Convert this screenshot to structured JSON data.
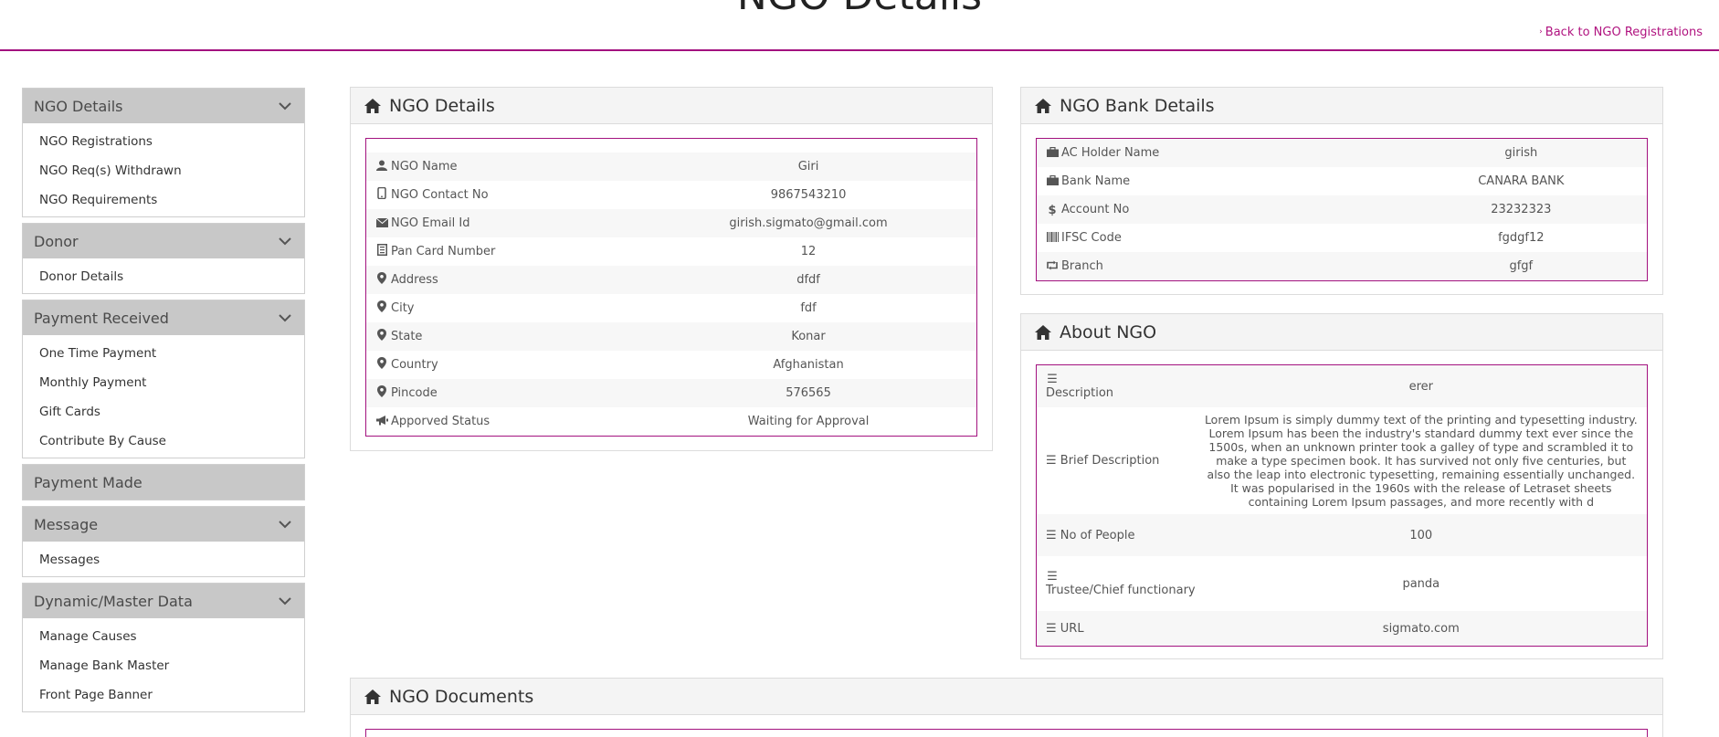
{
  "page": {
    "title": "NGO Details",
    "back_link": "Back to NGO Registrations"
  },
  "sidebar": {
    "groups": [
      {
        "title": "NGO Details",
        "has_chevron": true,
        "items": [
          "NGO Registrations",
          "NGO Req(s) Withdrawn",
          "NGO Requirements"
        ]
      },
      {
        "title": "Donor",
        "has_chevron": true,
        "items": [
          "Donor Details"
        ]
      },
      {
        "title": "Payment Received",
        "has_chevron": true,
        "items": [
          "One Time Payment",
          "Monthly Payment",
          "Gift Cards",
          "Contribute By Cause"
        ]
      },
      {
        "title": "Payment Made",
        "has_chevron": false,
        "items": []
      },
      {
        "title": "Message",
        "has_chevron": true,
        "items": [
          "Messages"
        ]
      },
      {
        "title": "Dynamic/Master Data",
        "has_chevron": true,
        "items": [
          "Manage Causes",
          "Manage Bank Master",
          "Front Page Banner"
        ]
      }
    ]
  },
  "ngo_details": {
    "title": "NGO Details",
    "rows": [
      {
        "icon": "user-icon",
        "label": "NGO Name",
        "value": "Giri"
      },
      {
        "icon": "phone-icon",
        "label": "NGO Contact No",
        "value": "9867543210"
      },
      {
        "icon": "envelope-icon",
        "label": "NGO Email Id",
        "value": "girish.sigmato@gmail.com"
      },
      {
        "icon": "card-icon",
        "label": "Pan Card Number",
        "value": "12"
      },
      {
        "icon": "map-marker-icon",
        "label": "Address",
        "value": "dfdf"
      },
      {
        "icon": "map-marker-icon",
        "label": "City",
        "value": "fdf"
      },
      {
        "icon": "map-marker-icon",
        "label": "State",
        "value": "Konar"
      },
      {
        "icon": "map-marker-icon",
        "label": "Country",
        "value": "Afghanistan"
      },
      {
        "icon": "map-marker-icon",
        "label": "Pincode",
        "value": "576565"
      },
      {
        "icon": "bullhorn-icon",
        "label": "Apporved Status",
        "value": "Waiting for Approval"
      }
    ]
  },
  "bank_details": {
    "title": "NGO Bank Details",
    "rows": [
      {
        "icon": "briefcase-icon",
        "label": "AC Holder Name",
        "value": "girish"
      },
      {
        "icon": "briefcase-icon",
        "label": "Bank Name",
        "value": "CANARA BANK"
      },
      {
        "icon": "dollar-icon",
        "label": "Account No",
        "value": "23232323"
      },
      {
        "icon": "barcode-icon",
        "label": "IFSC Code",
        "value": "fgdgf12"
      },
      {
        "icon": "retweet-icon",
        "label": "Branch",
        "value": "gfgf"
      }
    ]
  },
  "about": {
    "title": "About NGO",
    "rows": [
      {
        "icon": "list-icon",
        "label": "Description",
        "value": "erer"
      },
      {
        "icon": "list-icon",
        "label": "Brief Description",
        "value": "Lorem Ipsum is simply dummy text of the printing and typesetting industry. Lorem Ipsum has been the industry's standard dummy text ever since the 1500s, when an unknown printer took a galley of type and scrambled it to make a type specimen book. It has survived not only five centuries, but also the leap into electronic typesetting, remaining essentially unchanged. It was popularised in the 1960s with the release of Letraset sheets containing Lorem Ipsum passages, and more recently with d"
      },
      {
        "icon": "list-icon",
        "label": "No of People",
        "value": "100"
      },
      {
        "icon": "list-icon",
        "label": "Trustee/Chief functionary",
        "value": "panda"
      },
      {
        "icon": "list-icon",
        "label": "URL",
        "value": "sigmato.com"
      }
    ]
  },
  "documents": {
    "title": "NGO Documents"
  },
  "colors": {
    "accent": "#a3127f",
    "sidebar_head": "#c8c8c8"
  }
}
